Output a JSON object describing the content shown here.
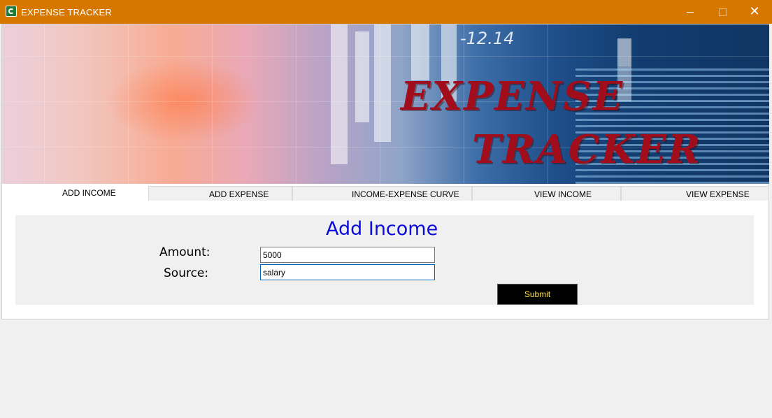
{
  "window": {
    "title": "EXPENSE TRACKER",
    "icon": "expense-tracker-app-icon",
    "controls": {
      "minimize": "minimize-icon",
      "maximize": "maximize-icon",
      "close": "close-icon"
    }
  },
  "banner": {
    "ticker": "-12.14",
    "logo_line1": "EXPENSE",
    "logo_line2": "TRACKER",
    "logo_color": "#a10d1a"
  },
  "tabs": [
    {
      "label": "ADD INCOME",
      "active": true
    },
    {
      "label": "ADD EXPENSE",
      "active": false
    },
    {
      "label": "INCOME-EXPENSE CURVE",
      "active": false
    },
    {
      "label": "VIEW INCOME",
      "active": false
    },
    {
      "label": "VIEW EXPENSE",
      "active": false
    }
  ],
  "form": {
    "title": "Add Income",
    "title_color": "#0b0bd9",
    "amount_label": "Amount:",
    "amount_value": "5000",
    "source_label": "Source:",
    "source_value": "salary",
    "submit_label": "Submit",
    "submit_text_color": "#ffe040"
  },
  "colors": {
    "titlebar": "#d67800",
    "window_bg": "#f0f0f0"
  }
}
